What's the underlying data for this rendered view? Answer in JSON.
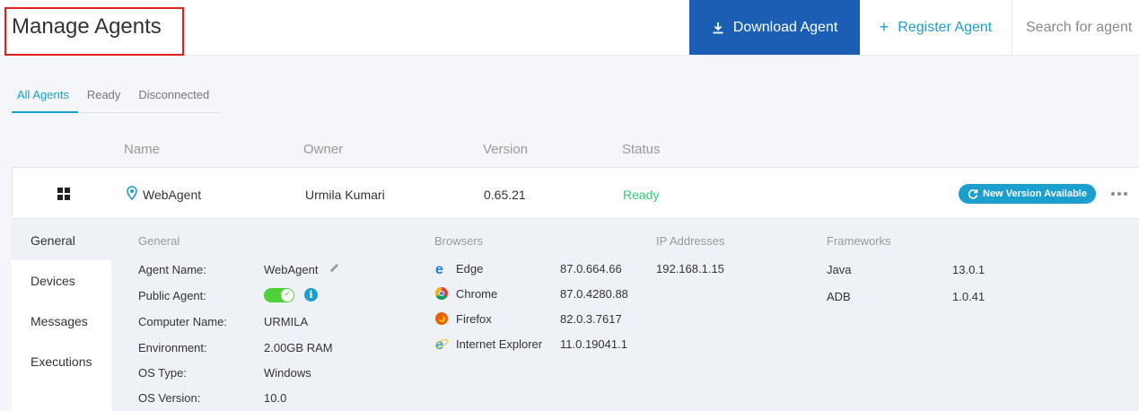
{
  "header": {
    "title": "Manage Agents",
    "download_label": "Download Agent",
    "register_label": "Register Agent",
    "search_placeholder": "Search for agent"
  },
  "tabs": [
    {
      "label": "All Agents",
      "active": true
    },
    {
      "label": "Ready",
      "active": false
    },
    {
      "label": "Disconnected",
      "active": false
    }
  ],
  "columns": {
    "name": "Name",
    "owner": "Owner",
    "version": "Version",
    "status": "Status"
  },
  "agent": {
    "os_icon": "windows-icon",
    "name": "WebAgent",
    "owner": "Urmila Kumari",
    "version": "0.65.21",
    "status": "Ready",
    "update_badge": "New Version Available"
  },
  "side_nav": [
    {
      "label": "General",
      "active": true
    },
    {
      "label": "Devices",
      "active": false
    },
    {
      "label": "Messages",
      "active": false
    },
    {
      "label": "Executions",
      "active": false
    }
  ],
  "general": {
    "title": "General",
    "fields": [
      {
        "label": "Agent Name:",
        "value": "WebAgent"
      },
      {
        "label": "Public Agent:",
        "value": ""
      },
      {
        "label": "Computer Name:",
        "value": "URMILA"
      },
      {
        "label": "Environment:",
        "value": "2.00GB RAM"
      },
      {
        "label": "OS Type:",
        "value": "Windows"
      },
      {
        "label": "OS Version:",
        "value": "10.0"
      }
    ],
    "public_agent_enabled": true
  },
  "browsers": {
    "title": "Browsers",
    "items": [
      {
        "name": "Edge",
        "version": "87.0.664.66",
        "icon": "edge-icon"
      },
      {
        "name": "Chrome",
        "version": "87.0.4280.88",
        "icon": "chrome-icon"
      },
      {
        "name": "Firefox",
        "version": "82.0.3.7617",
        "icon": "firefox-icon"
      },
      {
        "name": "Internet Explorer",
        "version": "11.0.19041.1",
        "icon": "ie-icon"
      }
    ]
  },
  "ip": {
    "title": "IP Addresses",
    "items": [
      "192.168.1.15"
    ]
  },
  "frameworks": {
    "title": "Frameworks",
    "items": [
      {
        "name": "Java",
        "version": "13.0.1"
      },
      {
        "name": "ADB",
        "version": "1.0.41"
      }
    ]
  },
  "colors": {
    "primary": "#1a5fb4",
    "accent": "#1a9fcf",
    "ready": "#2ecc71"
  }
}
